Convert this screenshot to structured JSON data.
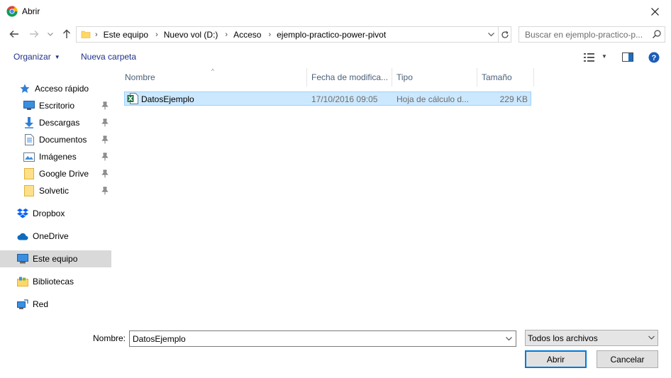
{
  "window": {
    "title": "Abrir"
  },
  "address": {
    "crumbs": [
      "Este equipo",
      "Nuevo vol (D:)",
      "Acceso",
      "ejemplo-practico-power-pivot"
    ]
  },
  "search": {
    "placeholder": "Buscar en ejemplo-practico-p..."
  },
  "commands": {
    "organize": "Organizar",
    "new_folder": "Nueva carpeta"
  },
  "sidebar": {
    "items": [
      {
        "label": "Acceso rápido",
        "icon": "star-icon"
      },
      {
        "label": "Escritorio",
        "icon": "desktop-icon",
        "pinned": true
      },
      {
        "label": "Descargas",
        "icon": "download-arrow-icon",
        "pinned": true
      },
      {
        "label": "Documentos",
        "icon": "document-icon",
        "pinned": true
      },
      {
        "label": "Imágenes",
        "icon": "pictures-icon",
        "pinned": true
      },
      {
        "label": "Google Drive",
        "icon": "folder-icon",
        "pinned": true
      },
      {
        "label": "Solvetic",
        "icon": "folder-icon",
        "pinned": true
      },
      {
        "label": "Dropbox",
        "icon": "dropbox-icon"
      },
      {
        "label": "OneDrive",
        "icon": "cloud-icon"
      },
      {
        "label": "Este equipo",
        "icon": "computer-icon",
        "selected": true
      },
      {
        "label": "Bibliotecas",
        "icon": "libraries-icon"
      },
      {
        "label": "Red",
        "icon": "network-icon"
      }
    ]
  },
  "columns": {
    "name": "Nombre",
    "date": "Fecha de modifica...",
    "type": "Tipo",
    "size": "Tamaño"
  },
  "files": [
    {
      "name": "DatosEjemplo",
      "date": "17/10/2016 09:05",
      "type": "Hoja de cálculo d...",
      "size": "229 KB",
      "selected": true
    }
  ],
  "footer": {
    "filename_label": "Nombre:",
    "filename_value": "DatosEjemplo",
    "filter": "Todos los archivos",
    "open": "Abrir",
    "cancel": "Cancelar"
  },
  "colors": {
    "accent": "#0078d7",
    "selection": "#cce8ff",
    "link": "#1e3287"
  }
}
